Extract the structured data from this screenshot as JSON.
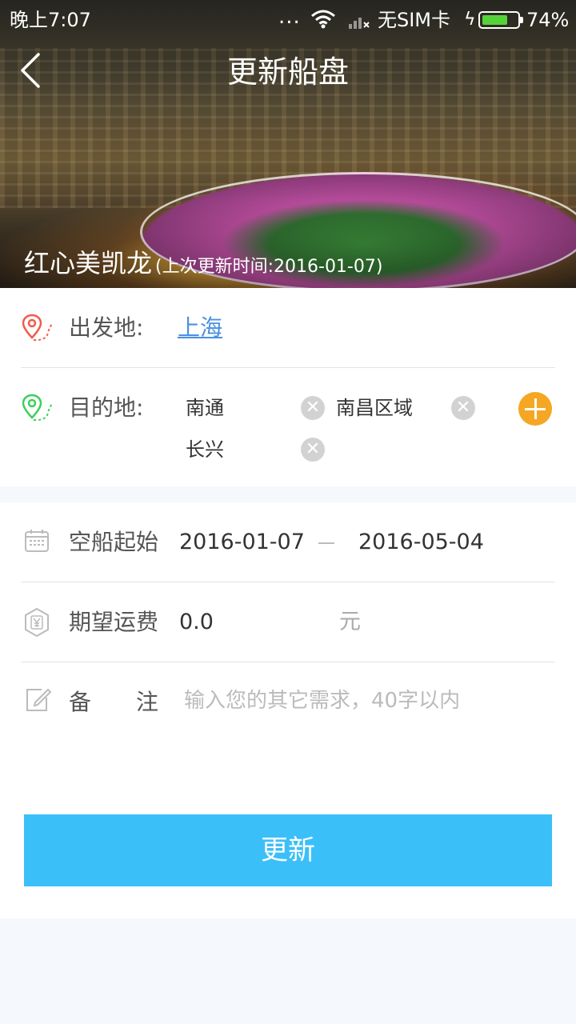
{
  "status_bar": {
    "time": "晚上7:07",
    "dots": "...",
    "carrier": "无SIM卡",
    "battery_percent": "74%",
    "battery_level": 0.74,
    "charging": true
  },
  "header": {
    "title": "更新船盘"
  },
  "ship": {
    "name": "红心美凯龙",
    "last_update": "(上次更新时间:2016-01-07)"
  },
  "route": {
    "origin_label": "出发地:",
    "origin_value": "上海",
    "destination_label": "目的地:",
    "destinations": [
      "南通",
      "南昌区域",
      "长兴"
    ],
    "remove_symbol": "✕"
  },
  "form": {
    "empty_start_label": "空船起始",
    "date_start": "2016-01-07",
    "date_end": "2016-05-04",
    "freight_label": "期望运费",
    "freight_value": "0.0",
    "freight_unit": "元",
    "remark_label_1": "备",
    "remark_label_2": "注",
    "remark_placeholder": "输入您的其它需求，40字以内",
    "submit_label": "更新"
  },
  "colors": {
    "accent_blue": "#3bbff9",
    "link_blue": "#4a90e2",
    "add_orange": "#f5a623",
    "origin_pin_red": "#f25a4a",
    "dest_pin_green": "#3ccf5a",
    "battery_green": "#55d23a"
  },
  "icons": {
    "back": "chevron-left-icon",
    "origin": "location-pin-red-icon",
    "destination": "location-pin-green-icon",
    "calendar": "calendar-icon",
    "freight": "yuan-shield-icon",
    "remark": "edit-pencil-icon",
    "add": "plus-circle-icon",
    "remove": "close-circle-icon"
  }
}
